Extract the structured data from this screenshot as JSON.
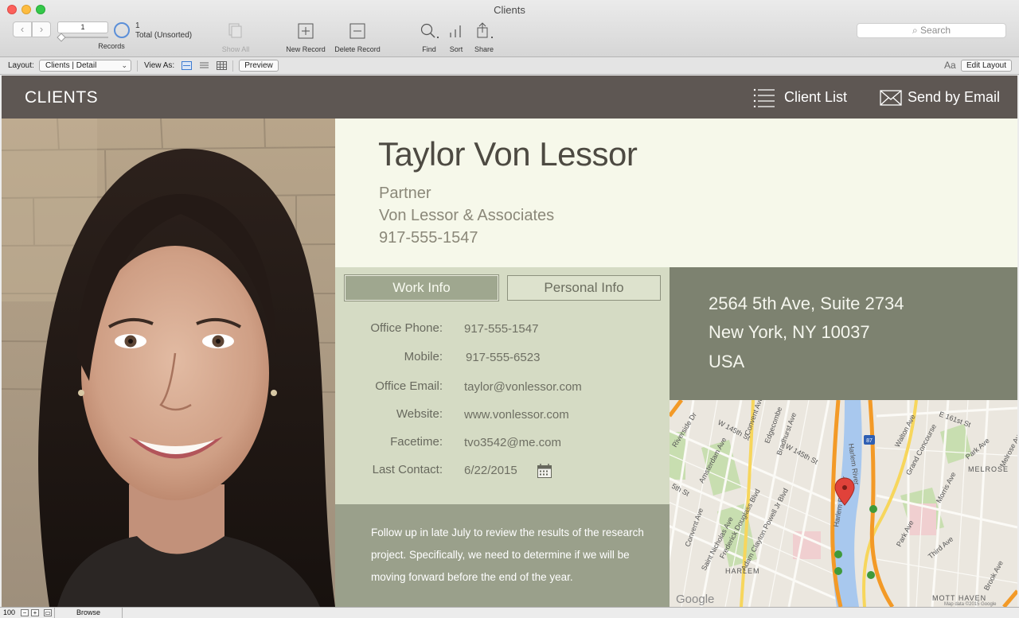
{
  "window": {
    "title": "Clients"
  },
  "toolbar": {
    "record_number": "1",
    "record_count": "1",
    "record_total": "Total (Unsorted)",
    "records_label": "Records",
    "show_all": "Show All",
    "new_record": "New Record",
    "delete_record": "Delete Record",
    "find": "Find",
    "sort": "Sort",
    "share": "Share",
    "search_placeholder": "Search"
  },
  "layout_bar": {
    "layout_label": "Layout:",
    "layout_value": "Clients | Detail",
    "view_as": "View As:",
    "preview": "Preview",
    "font_icon": "Aa",
    "edit_layout": "Edit Layout"
  },
  "header": {
    "title": "CLIENTS",
    "client_list": "Client List",
    "send_email": "Send by Email"
  },
  "client": {
    "name": "Taylor Von Lessor",
    "role": "Partner",
    "company": "Von Lessor & Associates",
    "phone": "917-555-1547"
  },
  "tabs": {
    "work": "Work Info",
    "personal": "Personal Info"
  },
  "fields": [
    {
      "label": "Office Phone:",
      "value": "917-555-1547"
    },
    {
      "label": "Mobile:",
      "value": "917-555-6523"
    },
    {
      "label": "Office Email:",
      "value": "taylor@vonlessor.com"
    },
    {
      "label": "Website:",
      "value": "www.vonlessor.com"
    },
    {
      "label": "Facetime:",
      "value": "tvo3542@me.com"
    },
    {
      "label": "Last Contact:",
      "value": "6/22/2015"
    }
  ],
  "notes": "Follow up in late July to review the results of the research project. Specifically, we need to determine if we will be moving forward before the end of the year.",
  "address": {
    "line1": "2564 5th Ave, Suite 2734",
    "line2": "New York, NY  10037",
    "line3": "USA"
  },
  "map_labels": {
    "w145": "W 145th St",
    "w145b": "W 145th St",
    "e161": "E 161st St",
    "riverside": "Riverside Dr",
    "amsterdam": "Amsterdam Ave",
    "convent": "Convent Ave",
    "edgecombe": "Edgecombe",
    "bradhurst": "Bradhurst Ave",
    "stnicholas": "Saint Nicholas Ave",
    "douglass": "Frederick Douglass Blvd",
    "powell": "Adam Clayton Powell Jr Blvd",
    "harlemriver": "Harlem River",
    "harlemriverdr": "Harlem River Dr",
    "harlem": "HARLEM",
    "melrose": "MELROSE",
    "motthaven": "MOTT HAVEN",
    "grandconcourse": "Grand Concourse",
    "walton": "Walton Ave",
    "morris": "Morris Ave",
    "park": "Park Ave",
    "parkave": "Park Ave",
    "third": "Third Ave",
    "brook": "Brook Ave",
    "melroseave": "Melrose Ave",
    "fifth": "5th St",
    "shield87": "87",
    "google": "Google",
    "credit": "Map data ©2015 Google"
  },
  "status_bar": {
    "zoom": "100",
    "mode": "Browse"
  }
}
